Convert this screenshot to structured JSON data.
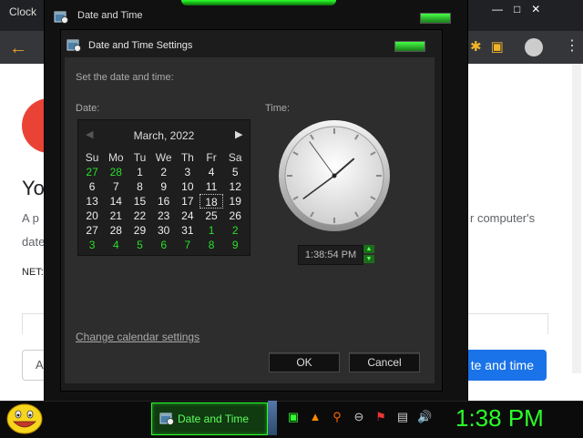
{
  "browser": {
    "tab_title": "Clock",
    "heading": "Yo",
    "paragraph_line1": "A p",
    "paragraph_line2": "date",
    "paragraph_right": "r computer's",
    "net_label": "NET:",
    "primary_button": "te and time",
    "cancel_fragment": "A"
  },
  "outer_window": {
    "title": "Date and Time"
  },
  "dialog": {
    "title": "Date and Time Settings",
    "instruction": "Set the date and time:",
    "date_label": "Date:",
    "time_label": "Time:",
    "calendar": {
      "month_label": "March, 2022",
      "days_of_week": [
        "Su",
        "Mo",
        "Tu",
        "We",
        "Th",
        "Fr",
        "Sa"
      ],
      "weeks": [
        [
          {
            "d": "27",
            "o": true
          },
          {
            "d": "28",
            "o": true
          },
          {
            "d": "1"
          },
          {
            "d": "2"
          },
          {
            "d": "3"
          },
          {
            "d": "4"
          },
          {
            "d": "5"
          }
        ],
        [
          {
            "d": "6"
          },
          {
            "d": "7"
          },
          {
            "d": "8"
          },
          {
            "d": "9"
          },
          {
            "d": "10"
          },
          {
            "d": "11"
          },
          {
            "d": "12"
          }
        ],
        [
          {
            "d": "13"
          },
          {
            "d": "14"
          },
          {
            "d": "15"
          },
          {
            "d": "16"
          },
          {
            "d": "17"
          },
          {
            "d": "18",
            "today": true
          },
          {
            "d": "19"
          }
        ],
        [
          {
            "d": "20"
          },
          {
            "d": "21"
          },
          {
            "d": "22"
          },
          {
            "d": "23"
          },
          {
            "d": "24"
          },
          {
            "d": "25"
          },
          {
            "d": "26"
          }
        ],
        [
          {
            "d": "27"
          },
          {
            "d": "28"
          },
          {
            "d": "29"
          },
          {
            "d": "30"
          },
          {
            "d": "31"
          },
          {
            "d": "1",
            "o": true
          },
          {
            "d": "2",
            "o": true
          }
        ],
        [
          {
            "d": "3",
            "o": true
          },
          {
            "d": "4",
            "o": true
          },
          {
            "d": "5",
            "o": true
          },
          {
            "d": "6",
            "o": true
          },
          {
            "d": "7",
            "o": true
          },
          {
            "d": "8",
            "o": true
          },
          {
            "d": "9",
            "o": true
          }
        ]
      ]
    },
    "time_value": "1:38:54 PM",
    "change_calendar_link": "Change calendar settings",
    "ok_label": "OK",
    "cancel_label": "Cancel"
  },
  "taskbar": {
    "task_label": "Date and Time",
    "clock": "1:38 PM",
    "tray_icons": [
      "terminal-icon",
      "vlc-icon",
      "search-icon",
      "minus-icon",
      "flag-icon",
      "network-icon",
      "volume-icon"
    ]
  },
  "colors": {
    "accent_green": "#2aff2a",
    "other_month_green": "#2adf2a",
    "dialog_bg": "#2d2d2d",
    "browser_button_blue": "#1a73e8"
  }
}
